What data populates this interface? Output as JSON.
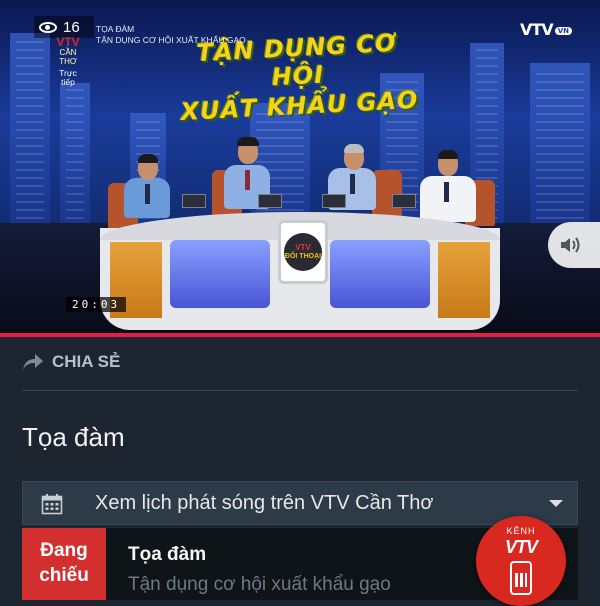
{
  "player": {
    "view_count": "16",
    "channel_logo_mark": "VTV",
    "channel_logo_sub": "CẦN THƠ",
    "live_label": "Trực tiếp",
    "program_category": "TỌA ĐÀM",
    "program_name": "TẬN DỤNG CƠ HỘI XUẤT KHẨU GẠO",
    "show_title_line1": "TẬN DỤNG CƠ HỘI",
    "show_title_line2": "XUẤT KHẨU GẠO",
    "vtv_logo": "VTV",
    "vtv_logo_suffix": "VN",
    "desk_logo_top": "VTV",
    "desk_logo_bottom": "ĐỐI THOẠI",
    "timecode": "20:03",
    "progress_color": "#e41e45"
  },
  "share": {
    "label": "CHIA SẺ"
  },
  "program": {
    "title": "Tọa đàm"
  },
  "schedule": {
    "label": "Xem lịch phát sóng trên VTV Cần Thơ"
  },
  "now_playing": {
    "badge_line1": "Đang",
    "badge_line2": "chiếu",
    "title": "Tọa đàm",
    "subtitle": "Tận dụng cơ hội xuất khẩu gạo",
    "badge_color": "#d32f2f"
  },
  "channel_button": {
    "label_top": "KÊNH",
    "label_brand": "VTV",
    "color": "#d9281f"
  }
}
